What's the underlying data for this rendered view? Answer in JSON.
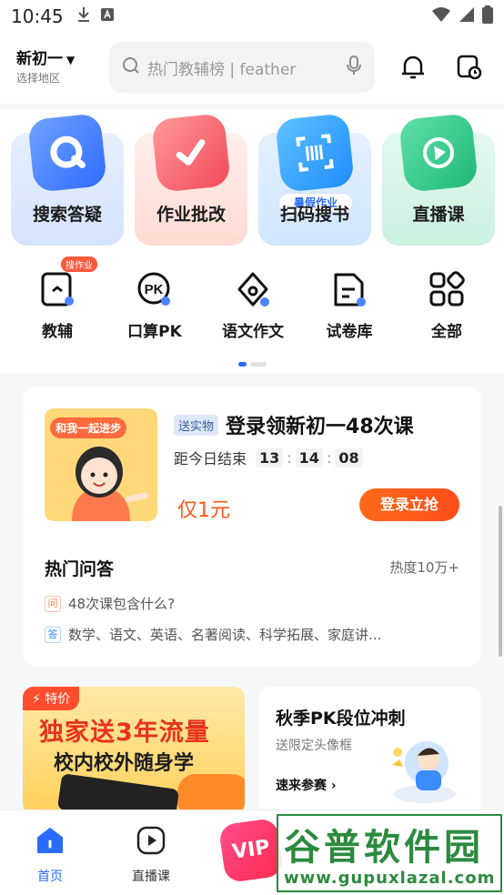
{
  "status_bar": {
    "time": "10:45"
  },
  "header": {
    "grade": "新初一",
    "region_hint": "选择地区",
    "search_placeholder": "热门教辅榜 | feather"
  },
  "tiles": [
    {
      "label": "搜索答疑"
    },
    {
      "label": "作业批改"
    },
    {
      "label": "扫码搜书",
      "tag": "暑假作业"
    },
    {
      "label": "直播课"
    }
  ],
  "shortcuts": [
    {
      "label": "教辅",
      "badge": "搜作业"
    },
    {
      "label": "口算PK",
      "icon_text": "PK"
    },
    {
      "label": "语文作文"
    },
    {
      "label": "试卷库"
    },
    {
      "label": "全部"
    }
  ],
  "promo": {
    "image_text": "和我一起进步",
    "tag": "送实物",
    "title": "登录领新初一48次课",
    "countdown_label": "距今日结束",
    "hours": "13",
    "minutes": "14",
    "seconds": "08",
    "price": "仅1元",
    "cta": "登录立抢"
  },
  "hot_qa": {
    "title": "热门问答",
    "heat": "热度10万+",
    "question_mark": "问",
    "question": "48次课包含什么?",
    "answer_mark": "答",
    "answer": "数学、语文、英语、名著阅读、科学拓展、家庭讲..."
  },
  "promo_left": {
    "tag": "特价",
    "line1": "独家送3年流量",
    "line2": "校内校外随身学"
  },
  "promo_right": {
    "title": "秋季PK段位冲刺",
    "subtitle": "送限定头像框",
    "cta": "速来参赛"
  },
  "bottom_nav": [
    {
      "label": "首页"
    },
    {
      "label": "直播课"
    },
    {
      "label": "VIP"
    }
  ],
  "watermark": {
    "line1": "谷普软件园",
    "line2": "www.gupuxlazal.com"
  },
  "colors": {
    "accent": "#2a6cff",
    "orange": "#ff5a1f",
    "watermark_green": "#2c8a3f"
  }
}
